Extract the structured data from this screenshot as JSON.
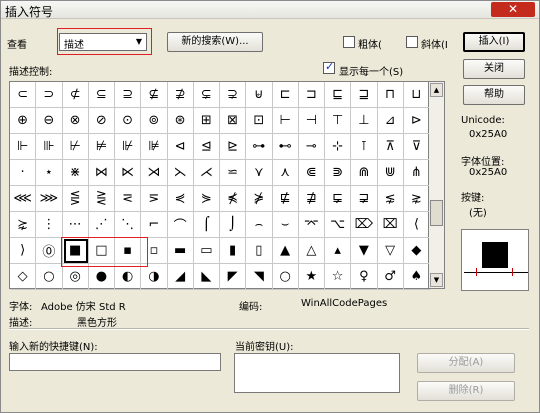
{
  "window": {
    "title": "插入符号",
    "close_label": "✕"
  },
  "toolbar": {
    "view_label": "查看",
    "view_value": "描述",
    "new_search_label": "新的搜索(W)...",
    "bold_label": "粗体(",
    "italic_label": "斜体(I",
    "insert_label": "插入(I)",
    "close_label": "关闭",
    "help_label": "帮助"
  },
  "grid_area": {
    "description_label": "描述控制:",
    "show_each_label": "显示每一个(S)",
    "show_each_checked": true,
    "symbols": [
      "⊂",
      "⊃",
      "⊄",
      "⊆",
      "⊇",
      "⊈",
      "⊉",
      "⊊",
      "⊋",
      "⊌",
      "⊏",
      "⊐",
      "⊑",
      "⊒",
      "⊓",
      "⊔",
      "⊕",
      "⊖",
      "⊗",
      "⊘",
      "⊙",
      "⊚",
      "⊛",
      "⊞",
      "⊠",
      "⊡",
      "⊢",
      "⊣",
      "⊤",
      "⊥",
      "⊿",
      "⊳",
      "⊩",
      "⊪",
      "⊬",
      "⊭",
      "⊮",
      "⊯",
      "⊲",
      "⊴",
      "⊵",
      "⊶",
      "⊷",
      "⊸",
      "⊹",
      "⊺",
      "⊼",
      "⊽",
      "·",
      "⋆",
      "⋇",
      "⋈",
      "⋉",
      "⋊",
      "⋋",
      "⋌",
      "⋍",
      "⋎",
      "⋏",
      "⋐",
      "⋑",
      "⋒",
      "⋓",
      "⋔",
      "⋘",
      "⋙",
      "⋚",
      "⋛",
      "⋜",
      "⋝",
      "⋞",
      "⋟",
      "⋠",
      "⋡",
      "⋢",
      "⋣",
      "⋤",
      "⋥",
      "⋦",
      "⋧",
      "⋩",
      "⋮",
      "⋯",
      "⋰",
      "⋱",
      "⌐",
      "⌒",
      "⌠",
      "⌡",
      "⌢",
      "⌣",
      "⌤",
      "⌥",
      "⌦",
      "⌧",
      "⟨",
      "⟩",
      "⓪",
      "■",
      "□",
      "▪",
      "▫",
      "▬",
      "▭",
      "▮",
      "▯",
      "▲",
      "△",
      "▴",
      "▼",
      "▽",
      "◆",
      "◇",
      "○",
      "◎",
      "●",
      "◐",
      "◑",
      "◢",
      "◣",
      "◤",
      "◥",
      "○",
      "★",
      "☆",
      "♀",
      "♂",
      "♠"
    ]
  },
  "info": {
    "unicode_label": "Unicode:",
    "unicode_value": "0x25A0",
    "font_pos_label": "字体位置:",
    "font_pos_value": "0x25A0",
    "key_label": "按键:",
    "key_value": "(无)",
    "font_label": "字体:",
    "font_value": "Adobe 仿宋 Std R",
    "encoding_label": "编码:",
    "encoding_value": "WinAllCodePages",
    "desc_label": "描述:",
    "desc_value": "黑色方形"
  },
  "shortcut": {
    "new_key_label": "输入新的快捷键(N):",
    "current_key_label": "当前密钥(U):",
    "assign_label": "分配(A)",
    "delete_label": "删除(R)"
  }
}
